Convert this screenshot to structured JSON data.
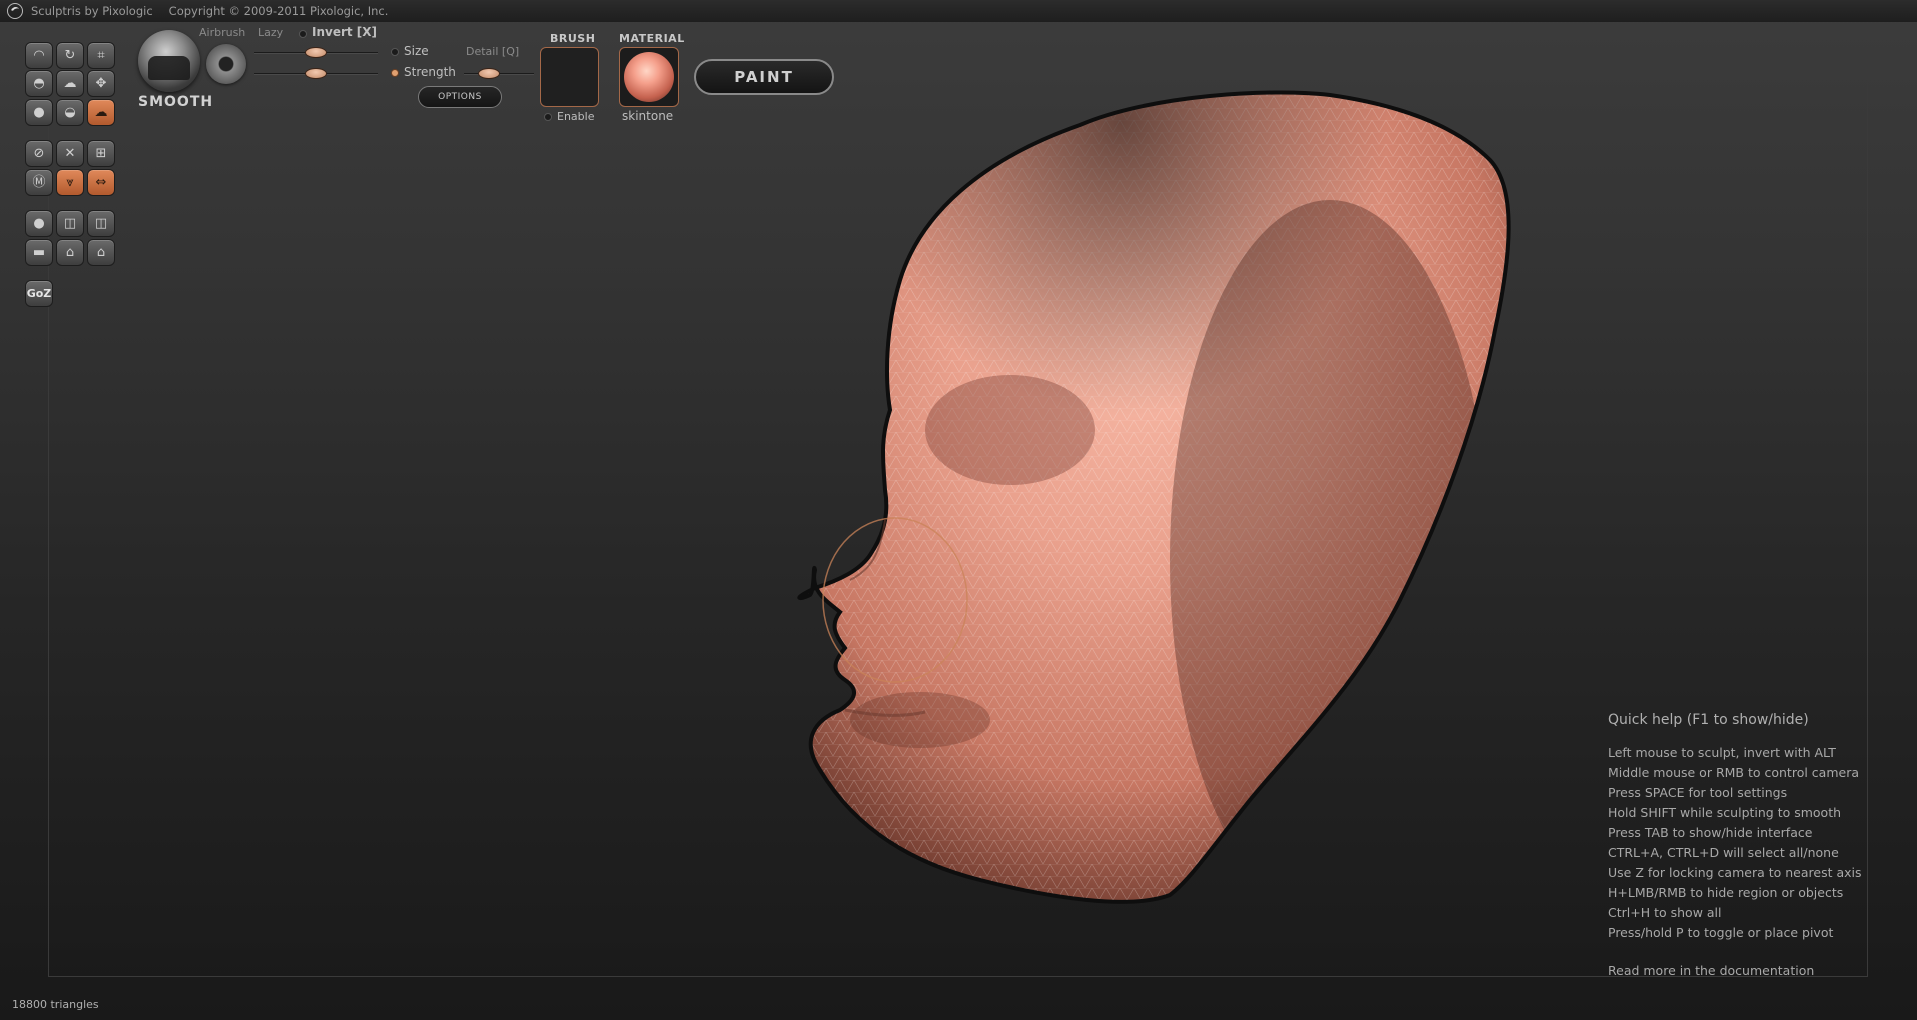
{
  "titlebar": {
    "app_name": "Sculptris by Pixologic",
    "copyright": "Copyright © 2009-2011 Pixologic, Inc."
  },
  "left_toolbar": {
    "rows": [
      [
        {
          "icon": "crease-icon"
        },
        {
          "icon": "rotate-icon"
        },
        {
          "icon": "scale-icon"
        }
      ],
      [
        {
          "icon": "draw-icon"
        },
        {
          "icon": "flatten-icon"
        },
        {
          "icon": "grab-icon"
        }
      ],
      [
        {
          "icon": "pinch-icon"
        },
        {
          "icon": "inflate-icon"
        },
        {
          "icon": "smooth-icon",
          "active": true
        }
      ],
      [
        {
          "icon": "reduce-brush-icon"
        },
        {
          "icon": "reduce-selection-icon"
        },
        {
          "icon": "subdivide-icon"
        }
      ],
      [
        {
          "icon": "mask-icon"
        },
        {
          "icon": "wireframe-icon",
          "active": true
        },
        {
          "icon": "symmetry-icon",
          "active": true
        }
      ],
      [
        {
          "icon": "new-sphere-icon"
        },
        {
          "icon": "open-icon"
        },
        {
          "icon": "save-icon"
        }
      ],
      [
        {
          "icon": "new-plane-icon"
        },
        {
          "icon": "import-icon"
        },
        {
          "icon": "export-icon"
        }
      ]
    ],
    "goz_label": "GoZ"
  },
  "brush_settings": {
    "mode": "SMOOTH",
    "airbrush_label": "Airbrush",
    "lazy_label": "Lazy",
    "invert_label": "Invert [X]",
    "size_label": "Size",
    "strength_label": "Strength",
    "detail_label": "Detail [Q]",
    "size_value": 0.5,
    "strength_value": 0.5,
    "detail_value": 0.35,
    "options_label": "OPTIONS"
  },
  "brush_panel": {
    "title": "BRUSH",
    "enable_label": "Enable"
  },
  "material_panel": {
    "title": "MATERIAL",
    "name": "skintone"
  },
  "paint_button": {
    "label": "PAINT"
  },
  "quick_help": {
    "title": "Quick help (F1 to show/hide)",
    "lines": [
      "Left mouse to sculpt, invert with ALT",
      "Middle mouse or RMB to control camera",
      "Press SPACE for tool settings",
      "Hold SHIFT while sculpting to smooth",
      "Press TAB to show/hide interface",
      "CTRL+A, CTRL+D will select all/none",
      "Use Z for locking camera to nearest axis",
      "H+LMB/RMB to hide region or objects",
      "Ctrl+H to show all",
      "Press/hold P to toggle or place pivot"
    ],
    "more": "Read more in the documentation"
  },
  "status": {
    "triangles": "18800 triangles"
  },
  "colors": {
    "accent": "#c96f44",
    "skin": "#e8a08e",
    "background": "#2a2a2a"
  }
}
